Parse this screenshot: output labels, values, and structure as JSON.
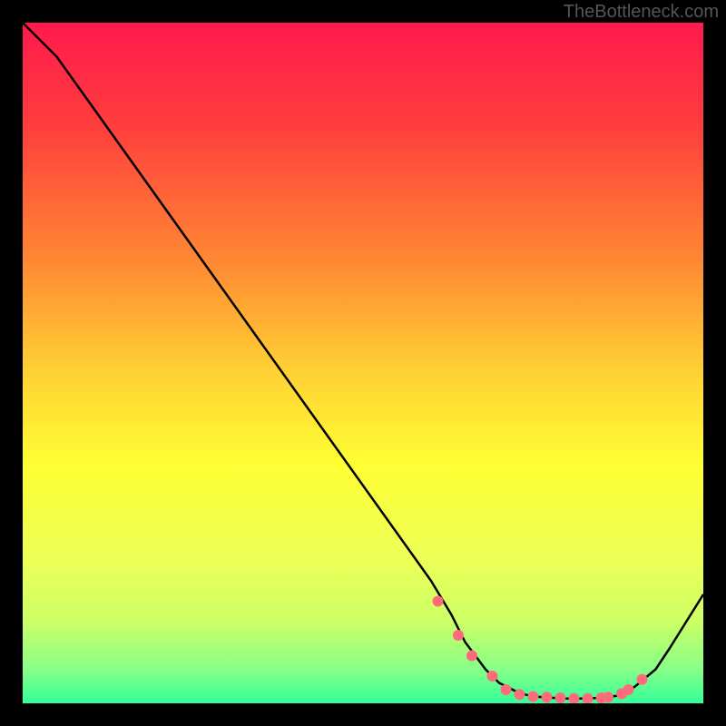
{
  "watermark": "TheBottleneck.com",
  "chart_data": {
    "type": "line",
    "title": "",
    "xlabel": "",
    "ylabel": "",
    "xlim": [
      0,
      100
    ],
    "ylim": [
      0,
      100
    ],
    "x": [
      0,
      3,
      5,
      10,
      15,
      20,
      25,
      30,
      35,
      40,
      45,
      50,
      55,
      60,
      63,
      65,
      68,
      70,
      73,
      75,
      78,
      80,
      82,
      85,
      88,
      90,
      93,
      95,
      100
    ],
    "y": [
      100,
      97,
      95,
      88,
      81,
      74,
      67,
      60,
      53,
      46,
      39,
      32,
      25,
      18,
      13,
      9,
      5,
      3,
      1.5,
      1,
      0.8,
      0.7,
      0.7,
      0.8,
      1.2,
      2.5,
      5,
      8,
      16
    ],
    "markers": {
      "x": [
        61,
        64,
        66,
        69,
        71,
        73,
        75,
        77,
        79,
        81,
        83,
        85,
        86,
        88,
        89,
        91
      ],
      "y": [
        15,
        10,
        7,
        4,
        2,
        1.3,
        1,
        0.9,
        0.8,
        0.7,
        0.7,
        0.8,
        0.9,
        1.4,
        2,
        3.5
      ]
    },
    "gradient_stops": [
      {
        "offset": 0,
        "color": "#ff1a4d"
      },
      {
        "offset": 15,
        "color": "#ff3d3d"
      },
      {
        "offset": 35,
        "color": "#ff8833"
      },
      {
        "offset": 50,
        "color": "#ffcc33"
      },
      {
        "offset": 65,
        "color": "#ffff33"
      },
      {
        "offset": 78,
        "color": "#eeff55"
      },
      {
        "offset": 88,
        "color": "#ccff66"
      },
      {
        "offset": 95,
        "color": "#88ff88"
      },
      {
        "offset": 100,
        "color": "#33ff99"
      }
    ],
    "marker_color": "#ff6b7a",
    "line_color": "#000000"
  }
}
